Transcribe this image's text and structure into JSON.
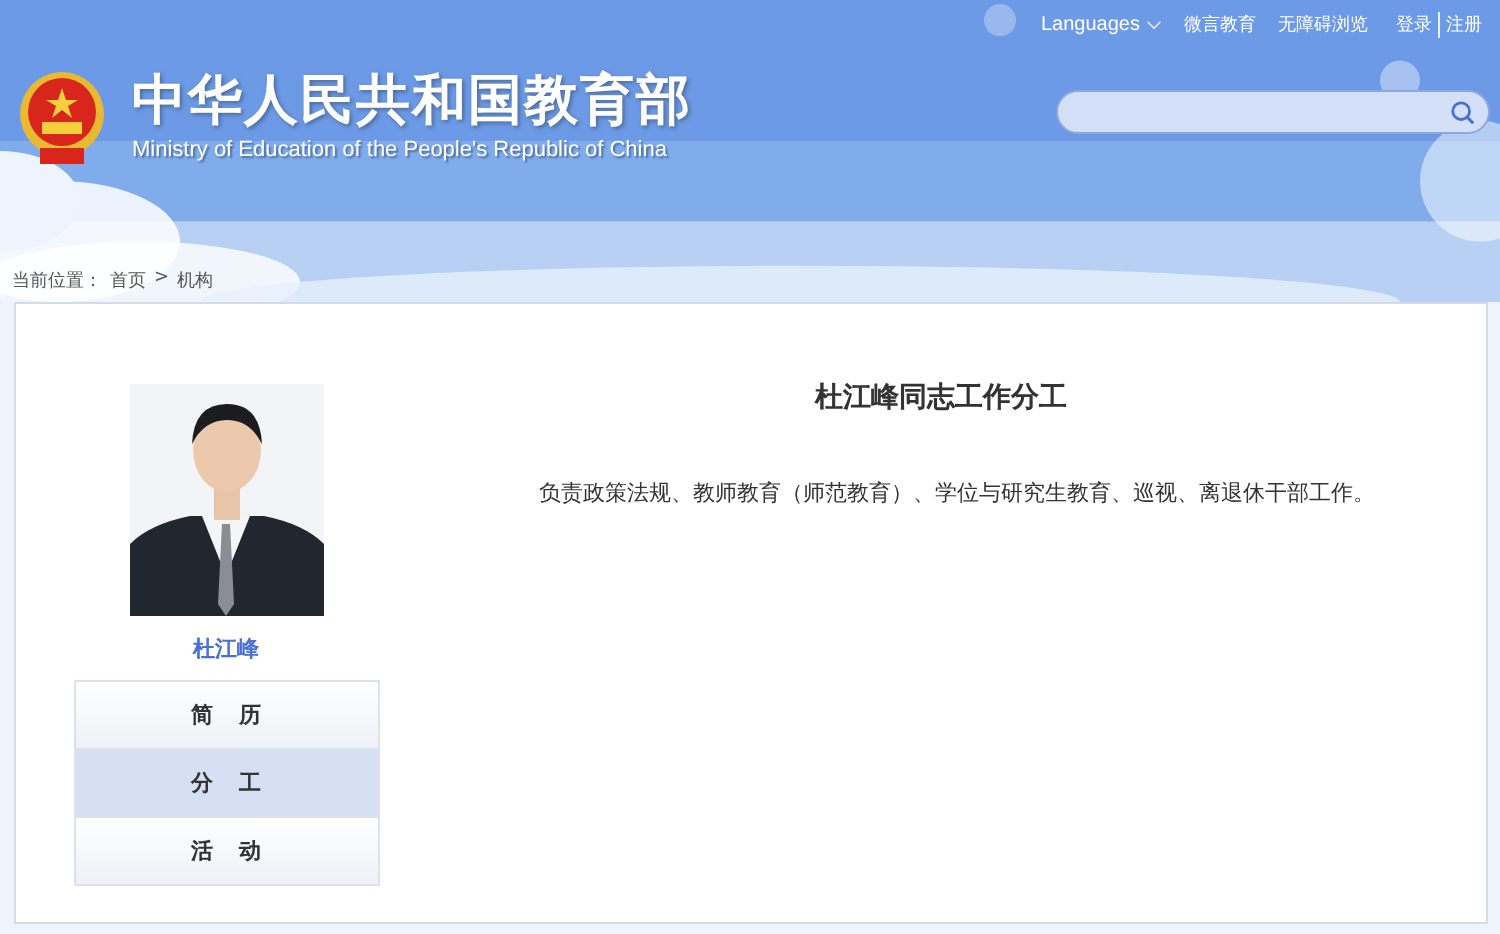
{
  "header": {
    "languages": "Languages",
    "top_links": [
      {
        "label": "微言教育"
      },
      {
        "label": "无障碍浏览"
      }
    ],
    "account_links": [
      {
        "label": "登录"
      },
      {
        "label": "注册"
      }
    ],
    "title": "中华人民共和国教育部",
    "subtitle": "Ministry of Education of the People's Republic of China"
  },
  "breadcrumb": {
    "prefix": "当前位置：",
    "separator": ">",
    "items": [
      {
        "label": "首页"
      },
      {
        "label": "机构"
      }
    ]
  },
  "profile": {
    "name": "杜江峰",
    "menu": [
      {
        "label": "简历",
        "selected": false
      },
      {
        "label": "分工",
        "selected": true
      },
      {
        "label": "活动",
        "selected": false
      }
    ]
  },
  "article": {
    "title": "杜江峰同志工作分工",
    "body": "负责政策法规、教师教育（师范教育）、学位与研究生教育、巡视、离退休干部工作。"
  }
}
